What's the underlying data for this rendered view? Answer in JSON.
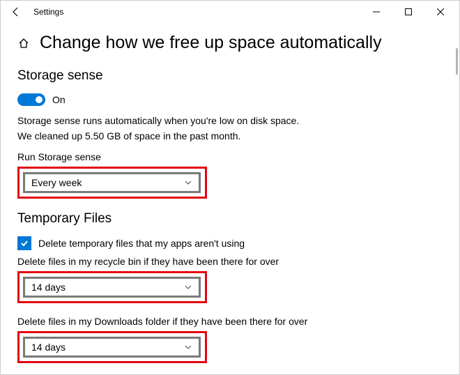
{
  "titlebar": {
    "title": "Settings"
  },
  "page": {
    "heading": "Change how we free up space automatically"
  },
  "storage_sense": {
    "heading": "Storage sense",
    "toggle_label": "On",
    "desc_line1": "Storage sense runs automatically when you're low on disk space.",
    "desc_line2": "We cleaned up 5.50 GB of space in the past month.",
    "run_label": "Run Storage sense",
    "run_value": "Every week"
  },
  "temp_files": {
    "heading": "Temporary Files",
    "checkbox_label": "Delete temporary files that my apps aren't using",
    "recycle_label": "Delete files in my recycle bin if they have been there for over",
    "recycle_value": "14 days",
    "downloads_label": "Delete files in my Downloads folder if they have been there for over",
    "downloads_value": "14 days"
  }
}
